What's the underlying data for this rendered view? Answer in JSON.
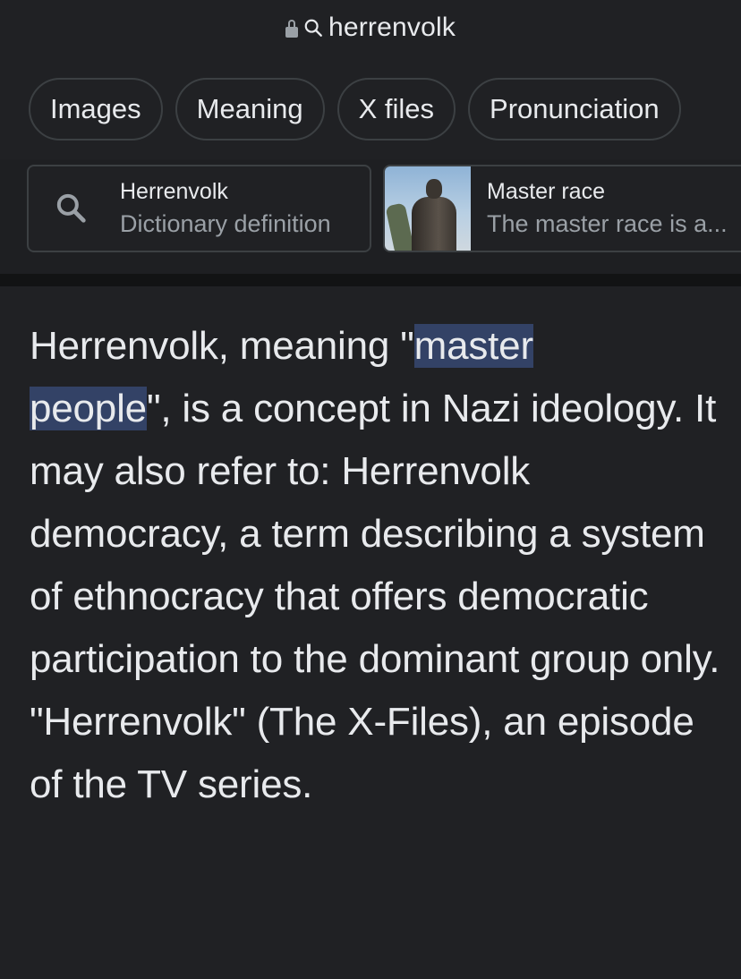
{
  "address_bar": {
    "query": "herrenvolk",
    "lock_icon": "lock-icon",
    "search_icon": "search-icon"
  },
  "chips": [
    {
      "label": "Images"
    },
    {
      "label": "Meaning"
    },
    {
      "label": "X files"
    },
    {
      "label": "Pronunciation"
    }
  ],
  "suggestions": [
    {
      "title": "Herrenvolk",
      "subtitle": "Dictionary definition",
      "icon": "search-icon"
    },
    {
      "title": "Master race",
      "subtitle": "The master race is a...",
      "thumbnail": "statue-thumbnail"
    }
  ],
  "snippet": {
    "prefix": "Herrenvolk, meaning \"",
    "highlight_1": "master",
    "highlight_2": "people",
    "rest": "\", is a concept in Nazi ideology. It may also refer to: Herrenvolk democracy, a term describing a system of ethnocracy that offers democratic participation to the dominant group only. \"Herrenvolk\" (The X-Files), an episode of the TV series."
  },
  "colors": {
    "background": "#202124",
    "text": "#e8eaed",
    "secondary_text": "#9aa0a6",
    "border": "#3c4043",
    "highlight": "#334266"
  }
}
